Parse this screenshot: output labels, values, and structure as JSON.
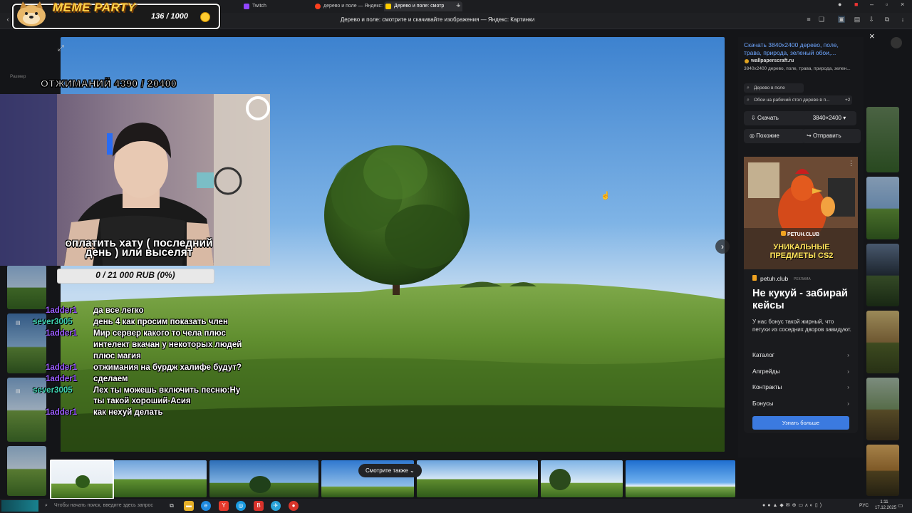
{
  "browser": {
    "tabs": [
      {
        "label": "tch",
        "icon_color": "#9146ff"
      },
      {
        "label": "Twitch",
        "icon_color": "#9146ff"
      },
      {
        "label": "дерево и поле — Яндекс:",
        "icon_color": "#fc3f1d"
      },
      {
        "label": "Дерево и поле: смотр",
        "icon_color": "#ffcc00"
      }
    ],
    "new_tab": "+",
    "page_title": "Дерево и поле: смотрите и скачивайте изображения — Яндекс: Картинки"
  },
  "viewer": {
    "close_icon": "×",
    "next_icon": "›",
    "size_label": "Размер"
  },
  "info": {
    "link_text": "Скачать 3840x2400 дерево, поле, трава, природа, зеленый обои,...",
    "domain": "wallpaperscraft.ru",
    "description": "3840x2400 дерево, поле, трава, природа, зелен...",
    "search_chips": [
      "Дерево в поле",
      "Обои на рабочий стол дерево в п..."
    ],
    "chip_more": "+2",
    "download_label": "Скачать",
    "resolution": "3840×2400",
    "similar_label": "Похожие",
    "share_label": "Отправить"
  },
  "ad": {
    "brand": "petuh.club",
    "ad_tag": "РЕКЛАМА",
    "image_brand": "PETUH.CLUB",
    "image_caption": "УНИКАЛЬНЫЕ ПРЕДМЕТЫ CS2",
    "title": "Не кукуй - забирай кейсы",
    "body": "У нас бонус такой жирный, что петухи из соседних дворов завидуют.",
    "links": [
      "Каталог",
      "Апгрейды",
      "Контракты",
      "Бонусы"
    ],
    "cta": "Узнать больше"
  },
  "thumbs": {
    "see_also": "Смотрите также"
  },
  "taskbar": {
    "search_placeholder": "Чтобы начать поиск, введите здесь запрос",
    "lang": "РУС",
    "time": "1:11",
    "date": "17.12.2025"
  },
  "overlay": {
    "meme_title": "MEME PARTY",
    "meme_count": "136 / 1000",
    "pushups": "ОТЖИМАНИЙ 4390 / 20400",
    "goal_text": "оплатить хату ( последний день ) или выселят",
    "goal_progress": "0 / 21 000 RUB (0%)",
    "goal_fraction": 0
  },
  "chat": [
    {
      "user": "1adder1",
      "text": "да все легко",
      "color": "purple",
      "badge": false
    },
    {
      "user": "sever3005",
      "text": "день 4 как просим показать член",
      "color": "teal",
      "badge": true
    },
    {
      "user": "1adder1",
      "text": "Мир сервер какого то чела плюс",
      "color": "purple",
      "badge": false
    },
    {
      "user": "",
      "text": "интелект вкачан у некоторых людей",
      "color": "purple",
      "badge": false
    },
    {
      "user": "",
      "text": "плюс магия",
      "color": "purple",
      "badge": false
    },
    {
      "user": "1adder1",
      "text": "отжимания на бурдж халифе будут?",
      "color": "purple",
      "badge": false
    },
    {
      "user": "1adder1",
      "text": "сделаем",
      "color": "purple",
      "badge": false
    },
    {
      "user": "sever3005",
      "text": "Лех ты можешь включить песню:Ну",
      "color": "teal",
      "badge": true
    },
    {
      "user": "",
      "text": "ты такой хороший-Асия",
      "color": "teal",
      "badge": false
    },
    {
      "user": "1adder1",
      "text": "как нехуй делать",
      "color": "purple",
      "badge": false
    }
  ]
}
